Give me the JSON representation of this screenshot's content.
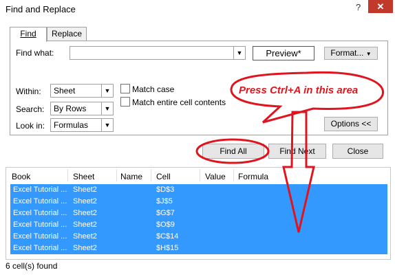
{
  "window": {
    "title": "Find and Replace",
    "help": "?",
    "close": "✕"
  },
  "tabs": [
    {
      "label": "Find"
    },
    {
      "label": "Replace"
    }
  ],
  "find": {
    "label": "Find what:",
    "value": "",
    "preview_label": "Preview*",
    "format_label": "Format...",
    "within_label": "Within:",
    "within_value": "Sheet",
    "search_label": "Search:",
    "search_value": "By Rows",
    "lookin_label": "Look in:",
    "lookin_value": "Formulas",
    "match_case_label": "Match case",
    "match_entire_label": "Match entire cell contents",
    "options_label": "Options <<"
  },
  "actions": {
    "find_all": "Find All",
    "find_next": "Find Next",
    "close": "Close"
  },
  "results": {
    "columns": [
      "Book",
      "Sheet",
      "Name",
      "Cell",
      "Value",
      "Formula"
    ],
    "rows": [
      {
        "book": "Excel Tutorial ...",
        "sheet": "Sheet2",
        "name": "",
        "cell": "$D$3"
      },
      {
        "book": "Excel Tutorial ...",
        "sheet": "Sheet2",
        "name": "",
        "cell": "$J$5"
      },
      {
        "book": "Excel Tutorial ...",
        "sheet": "Sheet2",
        "name": "",
        "cell": "$G$7"
      },
      {
        "book": "Excel Tutorial ...",
        "sheet": "Sheet2",
        "name": "",
        "cell": "$O$9"
      },
      {
        "book": "Excel Tutorial ...",
        "sheet": "Sheet2",
        "name": "",
        "cell": "$C$14"
      },
      {
        "book": "Excel Tutorial ...",
        "sheet": "Sheet2",
        "name": "",
        "cell": "$H$15"
      }
    ],
    "status": "6 cell(s) found"
  },
  "annotation": {
    "text": "Press Ctrl+A in this area",
    "color": "#e0141e"
  },
  "colors": {
    "selection": "#3399ff",
    "close_button": "#c0392b"
  }
}
